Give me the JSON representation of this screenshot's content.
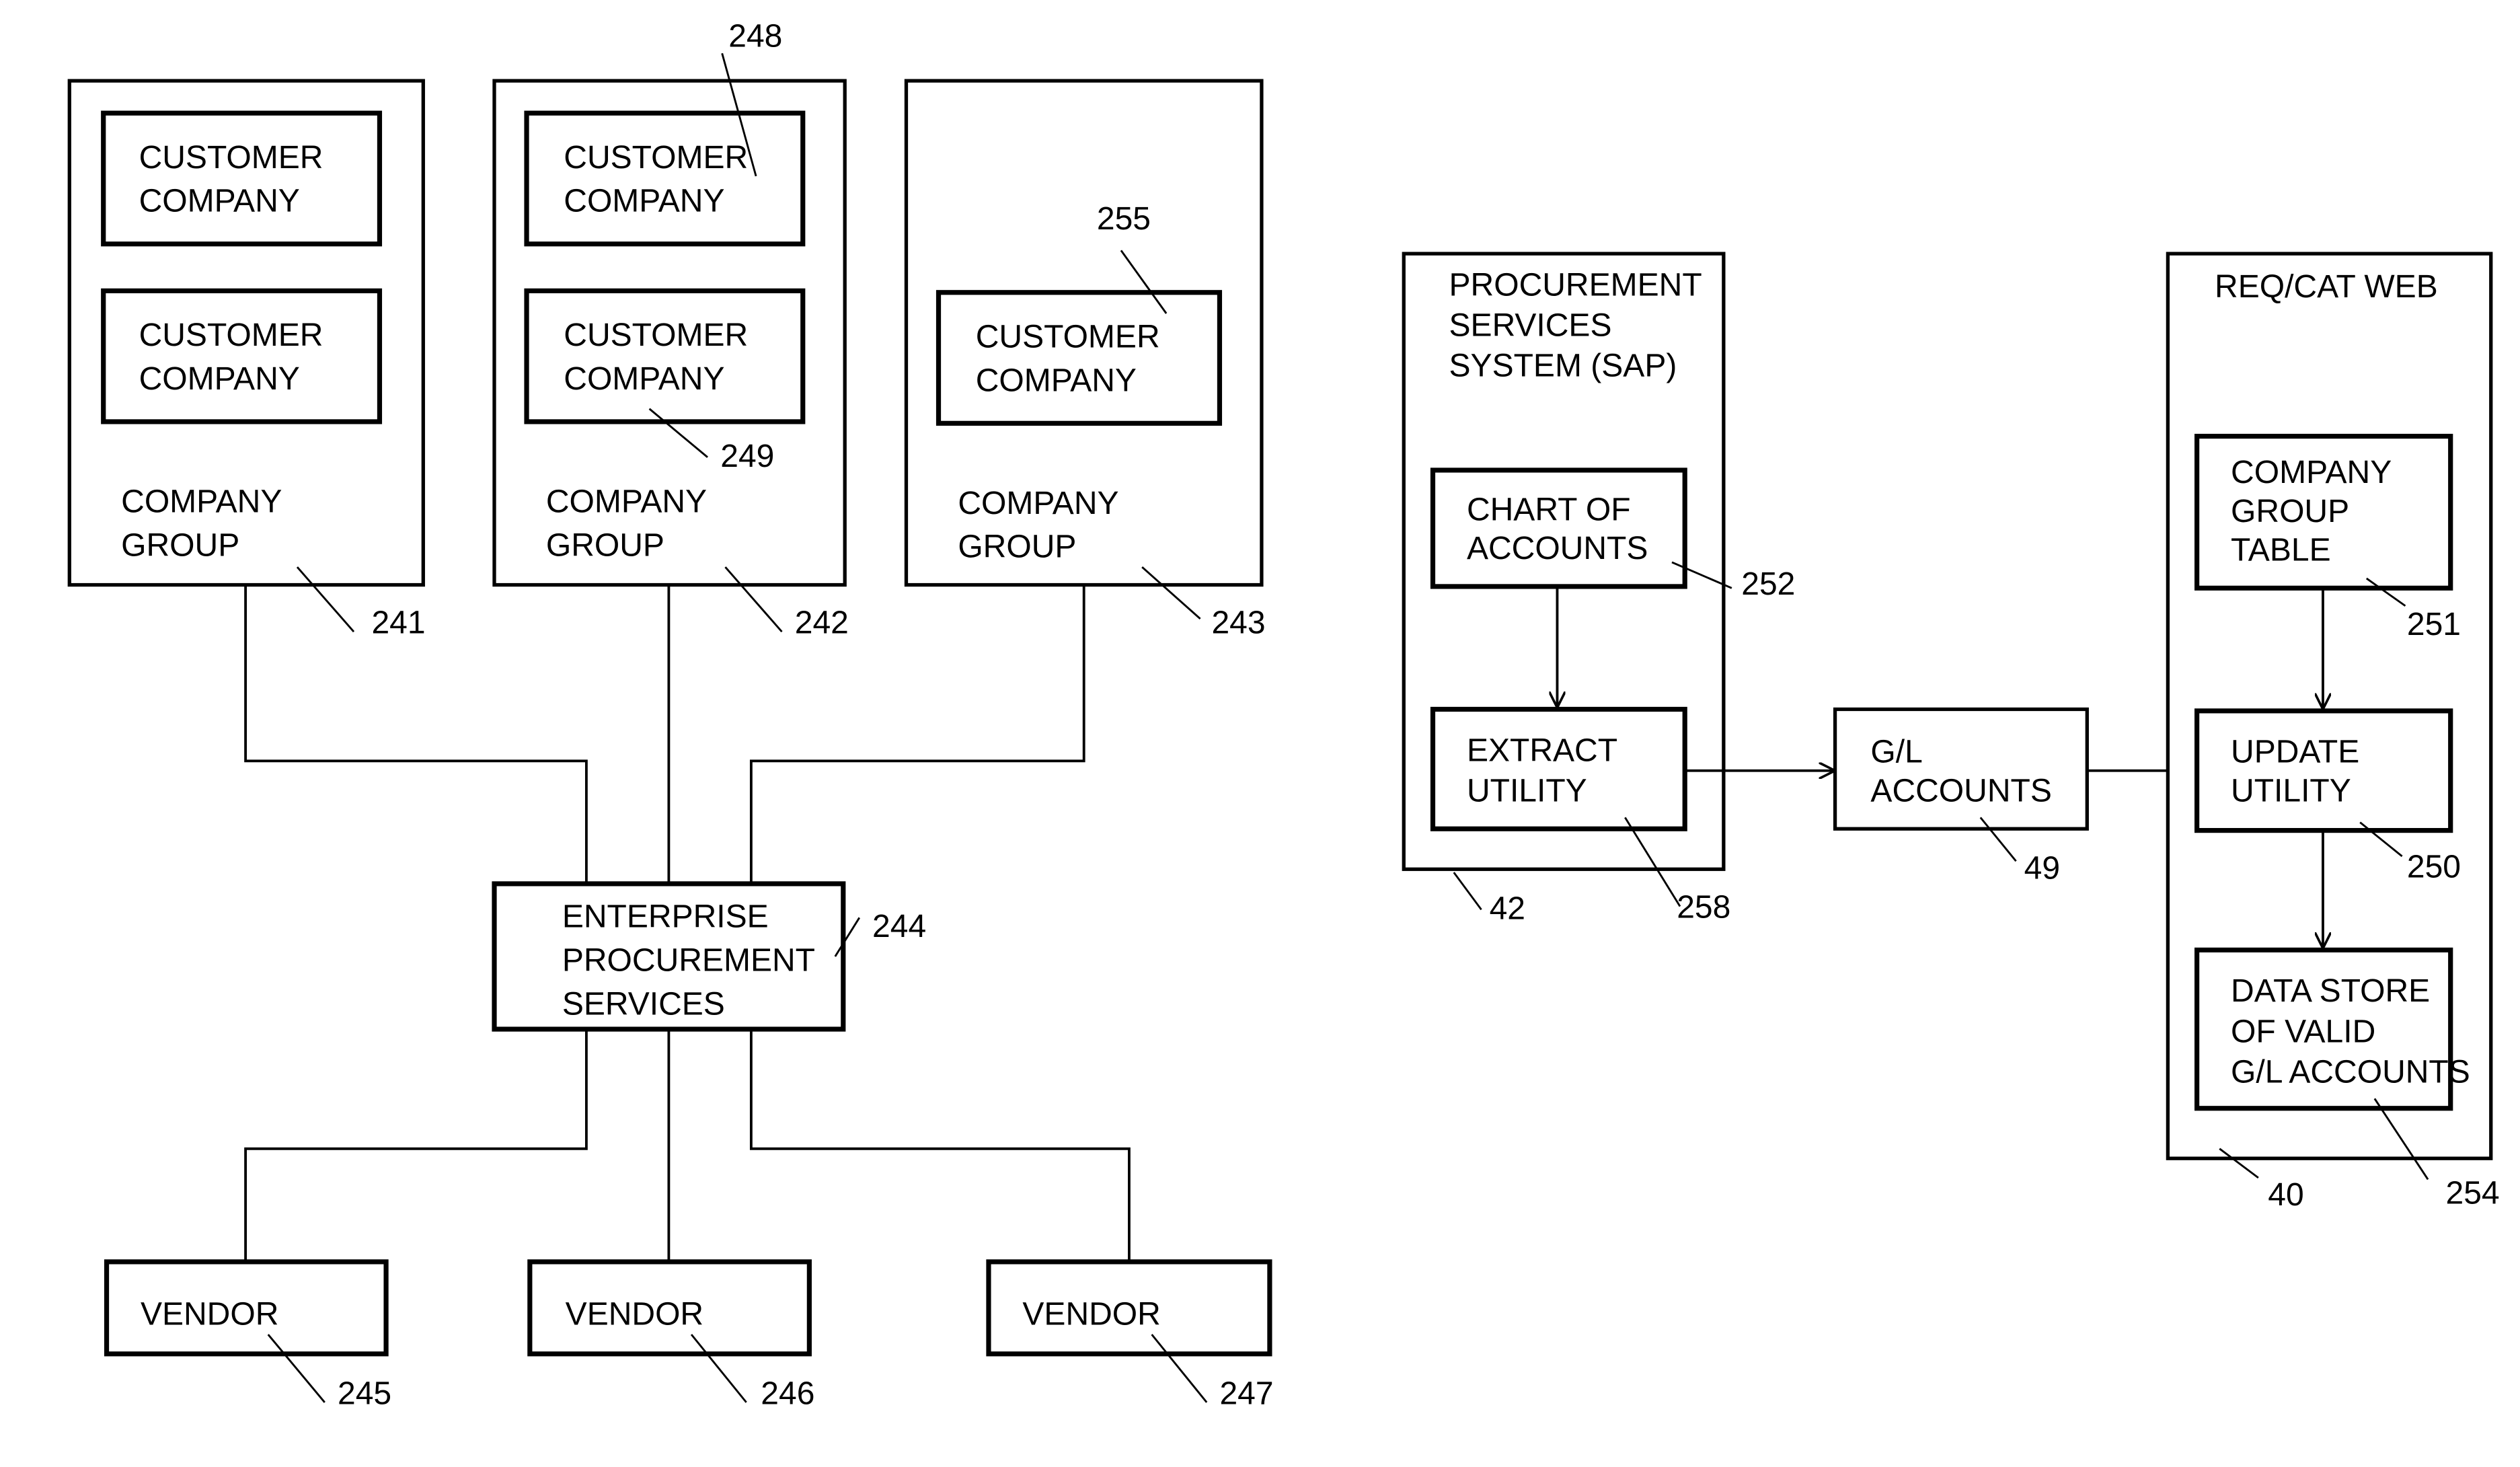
{
  "left_diagram": {
    "groups": [
      {
        "ref": "241",
        "label": [
          "COMPANY",
          "GROUP"
        ],
        "companies": [
          {
            "label": [
              "CUSTOMER",
              "COMPANY"
            ],
            "ref": ""
          },
          {
            "label": [
              "CUSTOMER",
              "COMPANY"
            ],
            "ref": ""
          }
        ]
      },
      {
        "ref": "242",
        "label": [
          "COMPANY",
          "GROUP"
        ],
        "companies": [
          {
            "label": [
              "CUSTOMER",
              "COMPANY"
            ],
            "ref": "248"
          },
          {
            "label": [
              "CUSTOMER",
              "COMPANY"
            ],
            "ref": "249"
          }
        ]
      },
      {
        "ref": "243",
        "label": [
          "COMPANY",
          "GROUP"
        ],
        "companies": [
          {
            "label": [
              "CUSTOMER",
              "COMPANY"
            ],
            "ref": "255"
          }
        ]
      }
    ],
    "hub": {
      "ref": "244",
      "label": [
        "ENTERPRISE",
        "PROCUREMENT",
        "SERVICES"
      ]
    },
    "vendors": [
      {
        "label": "VENDOR",
        "ref": "245"
      },
      {
        "label": "VENDOR",
        "ref": "246"
      },
      {
        "label": "VENDOR",
        "ref": "247"
      }
    ]
  },
  "right_diagram": {
    "sap": {
      "ref": "42",
      "label": [
        "PROCUREMENT",
        "SERVICES",
        "SYSTEM (SAP)"
      ],
      "chart_of_accounts": {
        "ref": "252",
        "label": [
          "CHART OF",
          "ACCOUNTS"
        ]
      },
      "extract_utility": {
        "ref": "258",
        "label": [
          "EXTRACT",
          "UTILITY"
        ]
      }
    },
    "gl_accounts": {
      "ref": "49",
      "label": [
        "G/L",
        "ACCOUNTS"
      ]
    },
    "reqcat": {
      "ref": "40",
      "label": "REQ/CAT WEB",
      "company_group_table": {
        "ref": "251",
        "label": [
          "COMPANY",
          "GROUP",
          "TABLE"
        ]
      },
      "update_utility": {
        "ref": "250",
        "label": [
          "UPDATE",
          "UTILITY"
        ]
      },
      "data_store": {
        "ref": "254",
        "label": [
          "DATA STORE",
          "OF VALID",
          "G/L ACCOUNTS"
        ]
      }
    }
  }
}
